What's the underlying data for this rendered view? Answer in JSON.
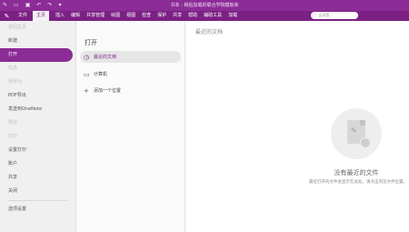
{
  "window": {
    "title": "书本 - 稍后加载的联合学院模板库"
  },
  "titlebar_icons": [
    "app-logo-icon",
    "folder-icon",
    "save-icon",
    "undo-icon",
    "redo-icon",
    "dropdown-icon"
  ],
  "menu": {
    "items": [
      "文件",
      "主页",
      "插入",
      "编辑",
      "共享管理",
      "绘图",
      "视图",
      "检查",
      "保护",
      "共享",
      "帮助",
      "辅助工具",
      "加载"
    ],
    "active_index": 0,
    "search_placeholder": "告诉我..."
  },
  "sidebar": {
    "items": [
      {
        "label": "返回主页",
        "state": "disabled"
      },
      {
        "label": "新建",
        "state": "normal"
      },
      {
        "label": "打开",
        "state": "active"
      },
      {
        "label": "信息",
        "state": "disabled"
      },
      {
        "label": "另存为",
        "state": "disabled"
      },
      {
        "label": "PDF导出",
        "state": "normal"
      },
      {
        "label": "发送到OneNote",
        "state": "normal"
      },
      {
        "label": "导出",
        "state": "disabled"
      },
      {
        "label": "打印",
        "state": "disabled"
      },
      {
        "label": "设置打印",
        "state": "normal"
      },
      {
        "label": "账户",
        "state": "normal"
      },
      {
        "label": "共享",
        "state": "normal"
      },
      {
        "label": "关闭",
        "state": "normal"
      }
    ],
    "footer": "选项设置"
  },
  "open_panel": {
    "title": "打开",
    "options": [
      {
        "label": "最近的文档",
        "icon": "clock-icon",
        "selected": true
      },
      {
        "label": "计算机",
        "icon": "computer-icon",
        "selected": false
      },
      {
        "label": "添加一个位置",
        "icon": "add-location-icon",
        "selected": false
      }
    ]
  },
  "recent": {
    "title": "最近的文档",
    "empty_title": "没有最近的文件",
    "empty_subtitle": "最近打开的文件会显示在此处，请点击浏览文件位置。"
  }
}
